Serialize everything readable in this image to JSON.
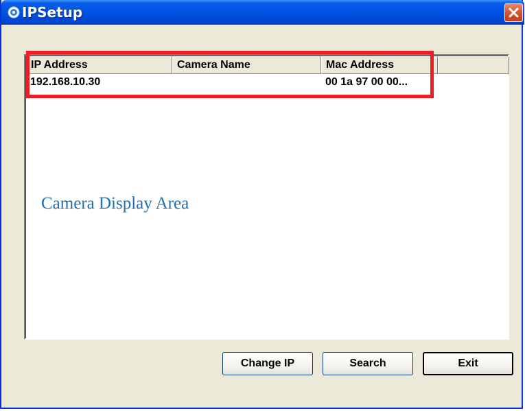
{
  "window": {
    "title": "IPSetup",
    "titlebar_color": "#0054e3",
    "close_button_color": "#d9532f",
    "close_icon": "close-icon",
    "app_icon": "app-icon"
  },
  "list": {
    "columns": [
      "IP Address",
      "Camera Name",
      "Mac Address",
      ""
    ],
    "rows": [
      {
        "ip": "192.168.10.30",
        "name": "",
        "mac": "00 1a 97 00 00..."
      }
    ]
  },
  "annotation": {
    "highlight_color": "#ee1c25",
    "display_area_label": "Camera Display Area",
    "label_color": "#1f6fb4"
  },
  "buttons": {
    "change_ip": "Change IP",
    "search": "Search",
    "exit": "Exit"
  }
}
